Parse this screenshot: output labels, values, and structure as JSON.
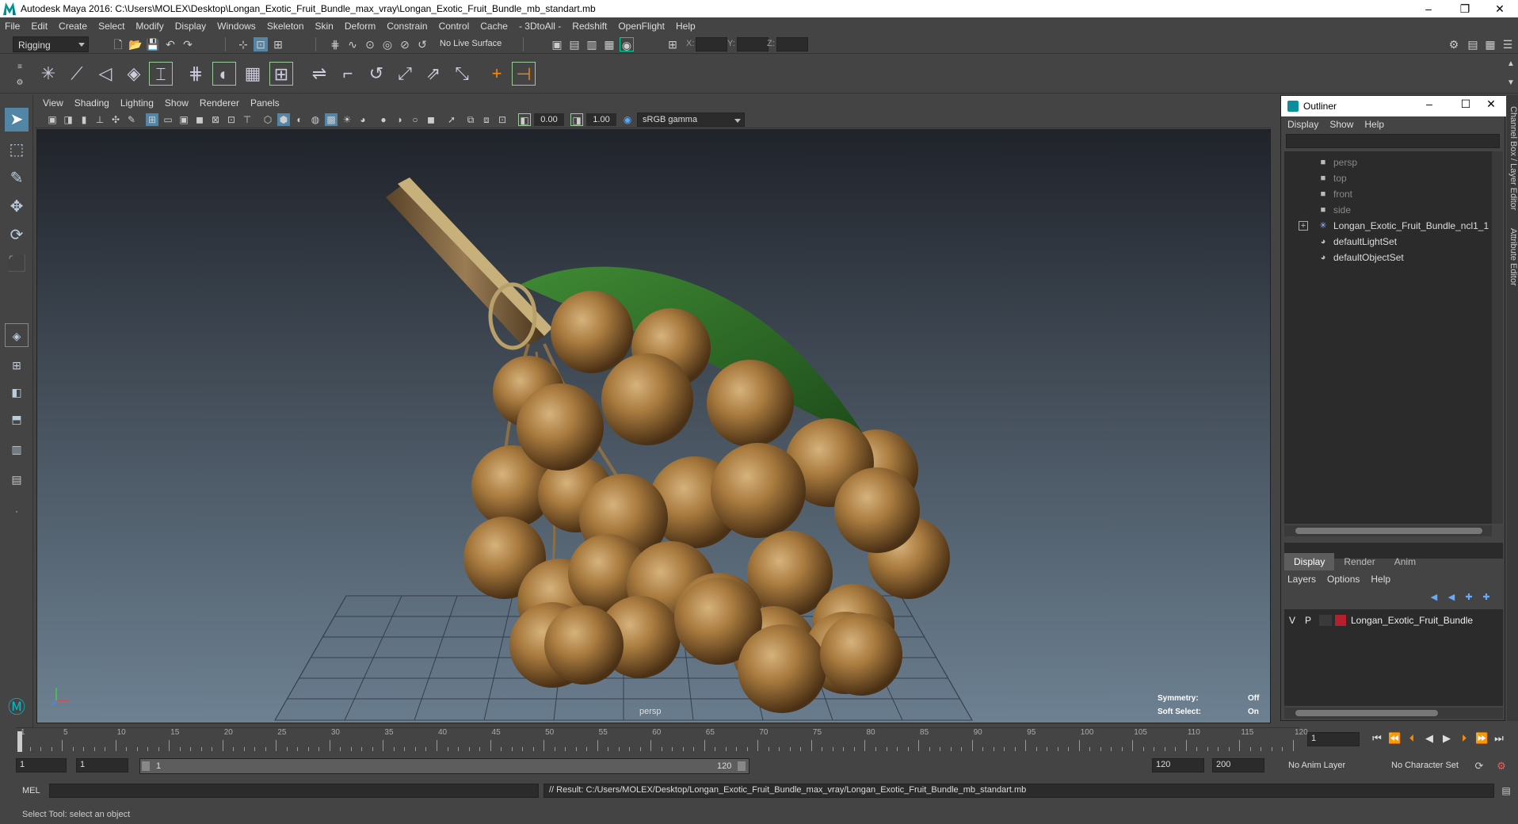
{
  "window": {
    "title": "Autodesk Maya 2016: C:\\Users\\MOLEX\\Desktop\\Longan_Exotic_Fruit_Bundle_max_vray\\Longan_Exotic_Fruit_Bundle_mb_standart.mb",
    "min": "–",
    "max": "❐",
    "close": "✕"
  },
  "menubar": [
    "File",
    "Edit",
    "Create",
    "Select",
    "Modify",
    "Display",
    "Windows",
    "Skeleton",
    "Skin",
    "Deform",
    "Constrain",
    "Control",
    "Cache",
    "- 3DtoAll -",
    "Redshift",
    "OpenFlight",
    "Help"
  ],
  "statusline": {
    "menuset": "Rigging",
    "live_surface": "No Live Surface",
    "x_label": "X:",
    "y_label": "Y:",
    "z_label": "Z:"
  },
  "viewport": {
    "menu": [
      "View",
      "Shading",
      "Lighting",
      "Show",
      "Renderer",
      "Panels"
    ],
    "exposure": "0.00",
    "gamma": "1.00",
    "color_space": "sRGB gamma",
    "camera_label": "persp",
    "hud": {
      "symmetry_label": "Symmetry:",
      "symmetry_value": "Off",
      "soft_select_label": "Soft Select:",
      "soft_select_value": "On"
    },
    "colors": {
      "bg_top": "#20232a",
      "bg_bottom": "#6d8192",
      "fruit": "#a87a3e",
      "leaf": "#2e6b2a"
    }
  },
  "outliner": {
    "title": "Outliner",
    "menu": [
      "Display",
      "Show",
      "Help"
    ],
    "items": [
      {
        "label": "persp",
        "icon": "camera-icon",
        "dim": true
      },
      {
        "label": "top",
        "icon": "camera-icon",
        "dim": true
      },
      {
        "label": "front",
        "icon": "camera-icon",
        "dim": true
      },
      {
        "label": "side",
        "icon": "camera-icon",
        "dim": true
      },
      {
        "label": "Longan_Exotic_Fruit_Bundle_ncl1_1",
        "icon": "transform-icon",
        "dim": false,
        "expandable": true
      },
      {
        "label": "defaultLightSet",
        "icon": "set-icon",
        "dim": false
      },
      {
        "label": "defaultObjectSet",
        "icon": "set-icon",
        "dim": false
      }
    ]
  },
  "layer_editor": {
    "tabs": [
      "Display",
      "Render",
      "Anim"
    ],
    "active_tab": "Display",
    "menu": [
      "Layers",
      "Options",
      "Help"
    ],
    "layer": {
      "visible": "V",
      "playback": "P",
      "name": "Longan_Exotic_Fruit_Bundle",
      "color": "#b4202d"
    }
  },
  "side_tabs": [
    "Channel Box / Layer Editor",
    "Attribute Editor"
  ],
  "timeline": {
    "ticks": [
      1,
      5,
      10,
      15,
      20,
      25,
      30,
      35,
      40,
      45,
      50,
      55,
      60,
      65,
      70,
      75,
      80,
      85,
      90,
      95,
      100,
      105,
      110,
      115,
      120
    ],
    "current_frame": "1"
  },
  "range": {
    "start": "1",
    "playback_start": "1",
    "slider_start": "1",
    "slider_end": "120",
    "playback_end": "120",
    "end": "200",
    "anim_layer": "No Anim Layer",
    "character_set": "No Character Set"
  },
  "cmdline": {
    "lang": "MEL",
    "result": "// Result: C:/Users/MOLEX/Desktop/Longan_Exotic_Fruit_Bundle_max_vray/Longan_Exotic_Fruit_Bundle_mb_standart.mb"
  },
  "helpline": "Select Tool: select an object"
}
